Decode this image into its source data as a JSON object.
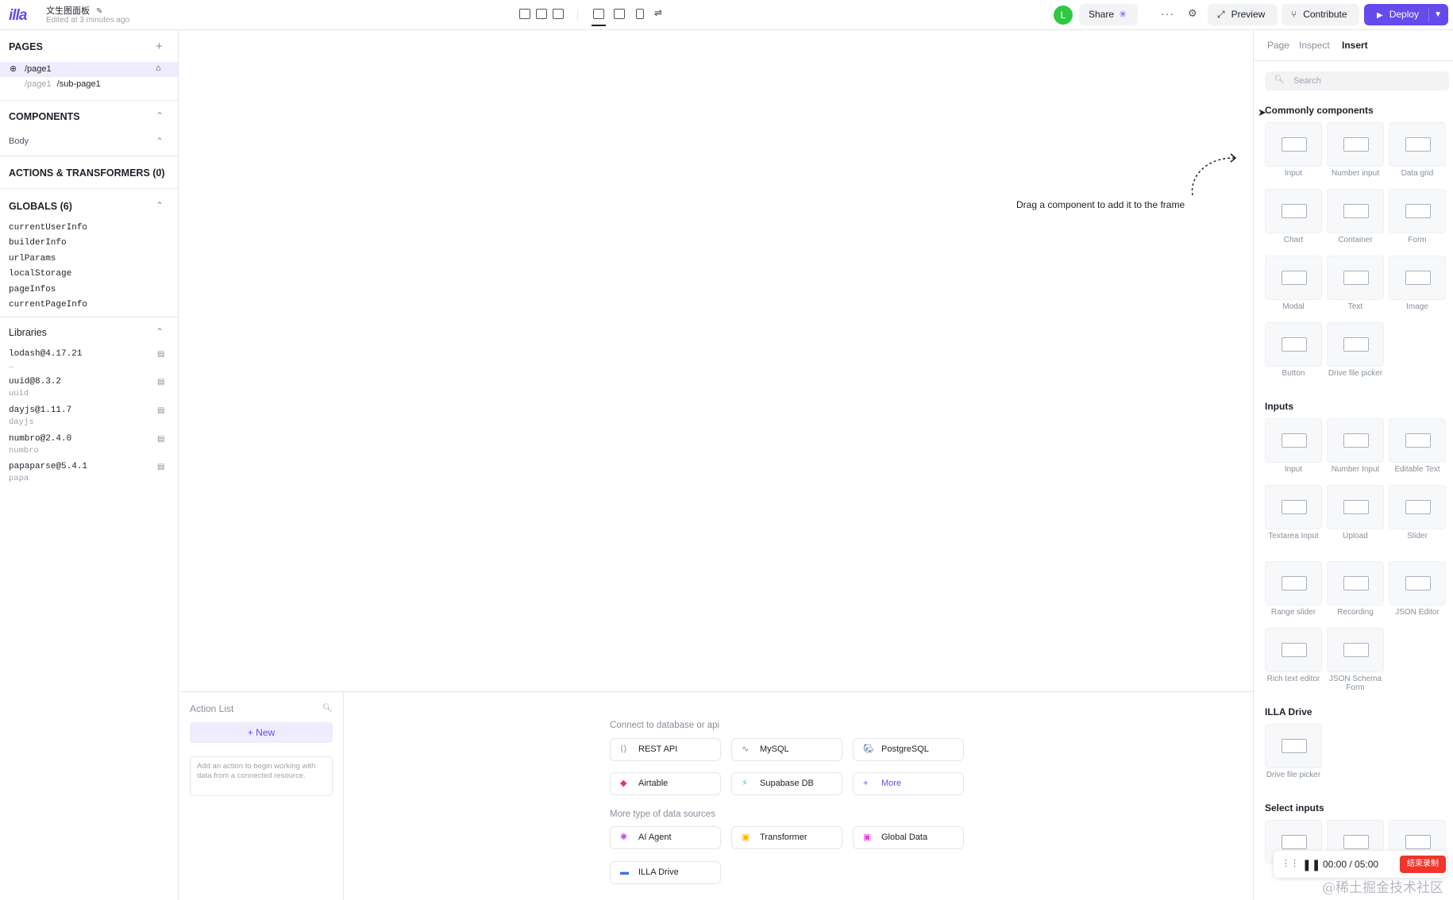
{
  "header": {
    "logo": "illa",
    "app_name": "文生图面板",
    "edited": "Edited at 3 minutes ago",
    "avatar_initial": "L",
    "share_label": "Share",
    "more_icon": "more-icon",
    "preview_label": "Preview",
    "contribute_label": "Contribute",
    "deploy_label": "Deploy",
    "accent": "#654aec"
  },
  "left": {
    "pages_title": "PAGES",
    "page1": "/page1",
    "subpage_parent": "/page1",
    "subpage": "/sub-page1",
    "components_title": "COMPONENTS",
    "body_label": "Body",
    "actions_title": "ACTIONS & TRANSFORMERS (0)",
    "globals_title": "GLOBALS (6)",
    "globals": [
      "currentUserInfo",
      "builderInfo",
      "urlParams",
      "localStorage",
      "pageInfos",
      "currentPageInfo"
    ],
    "libraries_title": "Libraries",
    "libraries": [
      {
        "name": "lodash@4.17.21",
        "alias": "_"
      },
      {
        "name": "uuid@8.3.2",
        "alias": "uuid"
      },
      {
        "name": "dayjs@1.11.7",
        "alias": "dayjs"
      },
      {
        "name": "numbro@2.4.0",
        "alias": "numbro"
      },
      {
        "name": "papaparse@5.4.1",
        "alias": "papa"
      }
    ]
  },
  "canvas": {
    "hint": "Drag a component to add it to the frame"
  },
  "action_list": {
    "title": "Action List",
    "new_label": "+ New",
    "empty_text": "Add an action to begin working with data from a connected resource."
  },
  "datasources": {
    "connect_title": "Connect to database or api",
    "connect": [
      "REST API",
      "MySQL",
      "PostgreSQL",
      "Airtable",
      "Supabase DB",
      "More"
    ],
    "more_title": "More type of data sources",
    "more": [
      "AI Agent",
      "Transformer",
      "Global Data",
      "ILLA Drive"
    ]
  },
  "right": {
    "tabs": [
      "Page",
      "Inspect",
      "Insert"
    ],
    "active_tab": "Insert",
    "search_placeholder": "Search",
    "categories": [
      {
        "title": "Commonly components",
        "items": [
          "Input",
          "Number input",
          "Data grid",
          "Chart",
          "Container",
          "Form",
          "Modal",
          "Text",
          "Image",
          "Button",
          "Drive file picker"
        ]
      },
      {
        "title": "Inputs",
        "items": [
          "Input",
          "Number Input",
          "Editable Text",
          "Textarea Input",
          "Upload",
          "Slider",
          "Range slider",
          "Recording",
          "JSON Editor",
          "Rich text editor",
          "JSON Schema Form"
        ]
      },
      {
        "title": "ILLA Drive",
        "items": [
          "Drive file picker"
        ]
      },
      {
        "title": "Select inputs",
        "items": [
          "",
          "",
          ""
        ]
      }
    ]
  },
  "recorder": {
    "time": "00:00 / 05:00",
    "stop_label": "结束录制"
  },
  "watermark": "@稀土掘金技术社区"
}
